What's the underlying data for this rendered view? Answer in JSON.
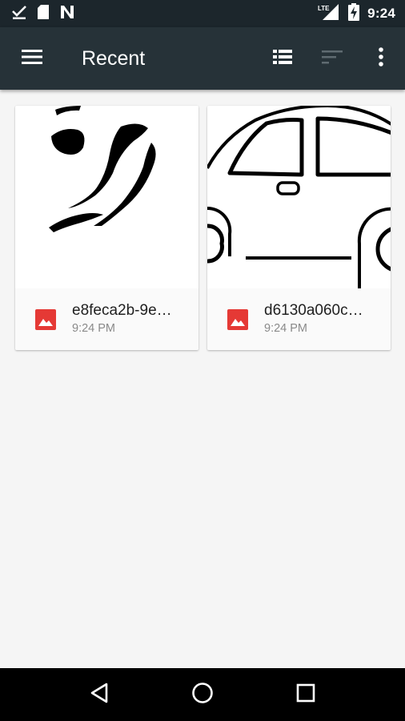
{
  "status_bar": {
    "time": "9:24",
    "network_label": "LTE",
    "icons": [
      "download-done-icon",
      "sd-card-icon",
      "n-icon",
      "lte-signal-icon",
      "battery-charging-icon"
    ]
  },
  "app_bar": {
    "title": "Recent",
    "background_color": "#263238",
    "actions": [
      "menu-icon",
      "list-view-icon",
      "sort-icon",
      "more-vert-icon"
    ]
  },
  "files": [
    {
      "name": "e8feca2b-9e…",
      "time": "9:24 PM",
      "type_icon": "image-file-icon",
      "icon_color": "#e53935"
    },
    {
      "name": "d6130a060c…",
      "time": "9:24 PM",
      "type_icon": "image-file-icon",
      "icon_color": "#e53935"
    }
  ],
  "nav_bar": {
    "buttons": [
      "back-icon",
      "home-icon",
      "recents-icon"
    ]
  }
}
